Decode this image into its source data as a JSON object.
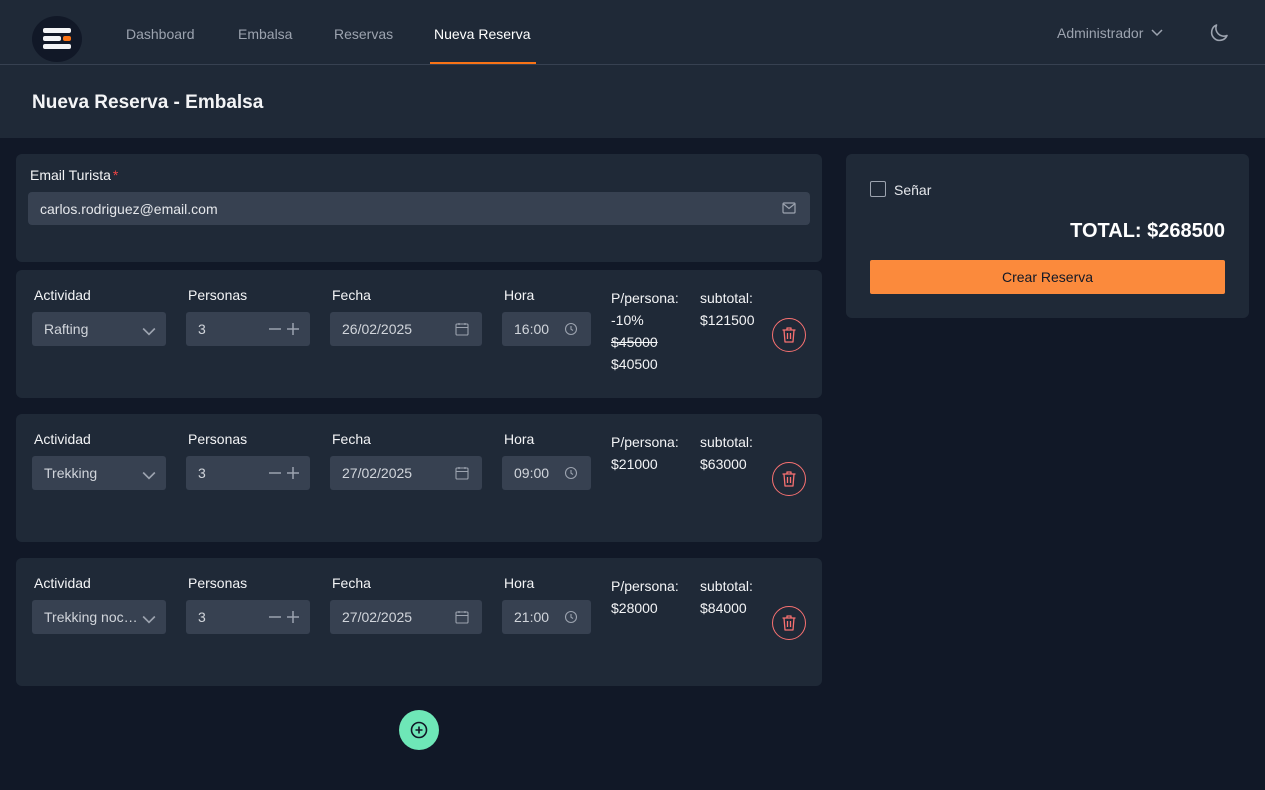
{
  "nav": {
    "items": [
      {
        "label": "Dashboard",
        "active": false
      },
      {
        "label": "Embalsa",
        "active": false
      },
      {
        "label": "Reservas",
        "active": false
      },
      {
        "label": "Nueva Reserva",
        "active": true
      }
    ],
    "user": "Administrador"
  },
  "page": {
    "title": "Nueva Reserva - Embalsa"
  },
  "form": {
    "email_label": "Email Turista",
    "required_mark": "*",
    "email_value": "carlos.rodriguez@email.com"
  },
  "labels": {
    "actividad": "Actividad",
    "personas": "Personas",
    "fecha": "Fecha",
    "hora": "Hora",
    "pp": "P/persona:",
    "subtotal": "subtotal:"
  },
  "activities": [
    {
      "actividad": "Rafting",
      "personas": "3",
      "fecha": "26/02/2025",
      "hora": "16:00",
      "discount": "-10%",
      "old_price": "$45000",
      "price": "$40500",
      "subtotal": "$121500"
    },
    {
      "actividad": "Trekking",
      "personas": "3",
      "fecha": "27/02/2025",
      "hora": "09:00",
      "price": "$21000",
      "subtotal": "$63000"
    },
    {
      "actividad": "Trekking noc…",
      "personas": "3",
      "fecha": "27/02/2025",
      "hora": "21:00",
      "price": "$28000",
      "subtotal": "$84000"
    }
  ],
  "summary": {
    "senar_label": "Señar",
    "senar_checked": false,
    "total": "TOTAL: $268500",
    "create_label": "Crear Reserva"
  },
  "colors": {
    "accent": "#f97316",
    "button": "#fb8a3c",
    "add": "#6ee7b7",
    "danger": "#f87171"
  },
  "icons": [
    "app-logo-icon",
    "chevron-down-icon",
    "moon-icon",
    "mail-icon",
    "minus-icon",
    "plus-icon",
    "calendar-icon",
    "clock-icon",
    "trash-icon",
    "plus-circle-icon"
  ]
}
